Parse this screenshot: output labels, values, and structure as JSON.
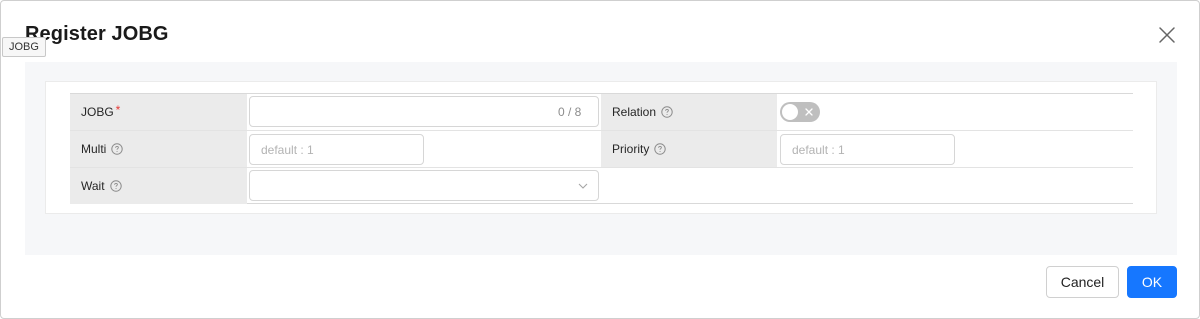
{
  "dialog": {
    "title": "Register JOBG",
    "tooltip": "JOBG"
  },
  "form": {
    "jobg": {
      "label": "JOBG",
      "required_mark": "*",
      "value": "",
      "counter": "0 / 8"
    },
    "relation": {
      "label": "Relation",
      "enabled": false
    },
    "multi": {
      "label": "Multi",
      "placeholder": "default : 1"
    },
    "priority": {
      "label": "Priority",
      "placeholder": "default : 1"
    },
    "wait": {
      "label": "Wait",
      "value": ""
    }
  },
  "footer": {
    "cancel_label": "Cancel",
    "ok_label": "OK"
  },
  "colors": {
    "primary": "#1677ff",
    "required": "#e53935",
    "switch_off": "#bfbfbf"
  },
  "icons": {
    "close": "close-icon",
    "help": "question-circle-icon",
    "select_arrow": "chevron-down-icon",
    "switch_off": "x-icon"
  }
}
